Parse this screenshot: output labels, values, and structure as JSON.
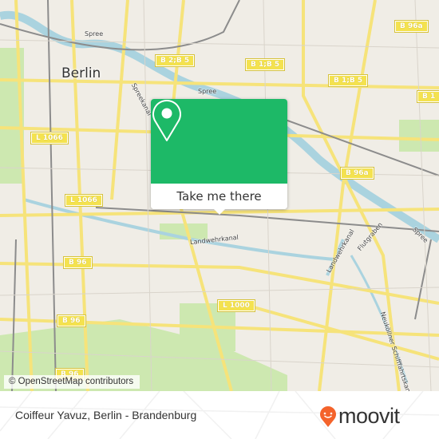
{
  "map": {
    "city_label": "Berlin",
    "shields": [
      {
        "text": "B 96a"
      },
      {
        "text": "B 2;B 5"
      },
      {
        "text": "B 1;B 5"
      },
      {
        "text": "B 1;B 5"
      },
      {
        "text": "B 1"
      },
      {
        "text": "L 1066"
      },
      {
        "text": "L 1066"
      },
      {
        "text": "B 96a"
      },
      {
        "text": "B 96"
      },
      {
        "text": "B 96"
      },
      {
        "text": "B 96"
      },
      {
        "text": "L 1000"
      }
    ],
    "labels": [
      "Spree",
      "Spree",
      "Spreekanal",
      "Landwehrkanal",
      "Landwehrkanal",
      "Flutgraben",
      "Spree",
      "Neuköllner Schifffahrtskanal"
    ],
    "colors": {
      "water": "#aad3df",
      "road": "#f6e37a",
      "park": "#cde8b0",
      "rail": "#888888",
      "background": "#f0ede6"
    }
  },
  "attribution": "© OpenStreetMap contributors",
  "popup": {
    "button_label": "Take me there",
    "color": "#1db967",
    "icon": "map-pin-icon"
  },
  "footer": {
    "title": "Coiffeur Yavuz, Berlin - Brandenburg",
    "logo_text": "moovit",
    "logo_color": "#f4632b"
  }
}
